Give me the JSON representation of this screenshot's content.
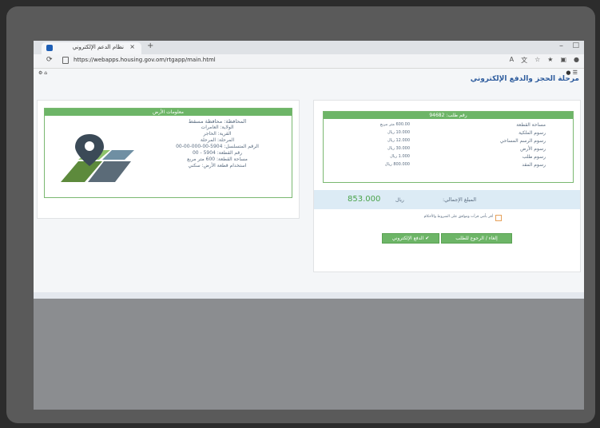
{
  "browser": {
    "tab_title": "نظام الدعم الإلكتروني",
    "tab_close": "×",
    "new_tab": "+",
    "url": "https://webapps.housing.gov.om/rtgapp/main.html",
    "minimize": "–",
    "maximize": "□"
  },
  "page": {
    "title": "مرحلة الحجز والدفع الإلكتروني"
  },
  "location": {
    "header": "معلومات الأرض",
    "lines": [
      "المحافظة: محافظة مسقط",
      "الولاية: العامرات",
      "القرية: الحاجر",
      "المرحلة: المرحلة",
      "الرقم المتسلسل: 5904-00-000-00-00",
      "رقم القطعة: 5904 - 00",
      "مساحة القطعة: 600 متر مربع",
      "استخدام قطعة الأرض: سكني"
    ]
  },
  "request": {
    "header": "رقم طلب: 94682",
    "rows": [
      {
        "label": "مساحة القطعة",
        "value": "600.00 متر مربع"
      },
      {
        "label": "رسوم الملكية",
        "value": "10.000 ريال"
      },
      {
        "label": "رسوم الرسم المساحي",
        "value": "12.000 ريال"
      },
      {
        "label": "رسوم الأرض",
        "value": "30.000 ريال"
      },
      {
        "label": "رسوم طلب",
        "value": "1.000 ريال"
      },
      {
        "label": "رسوم المقد",
        "value": "800.000 ريال"
      }
    ],
    "total_label": "المبلغ الإجمالي:",
    "total_value": "853.000",
    "total_currency": "ريال",
    "agree_text": "أقر بأنني قرأت وموافق على الشروط والأحكام",
    "pay_button": "✔ الدفع الإلكتروني",
    "cancel_button": "إلغاء / الرجوع للطلب"
  }
}
